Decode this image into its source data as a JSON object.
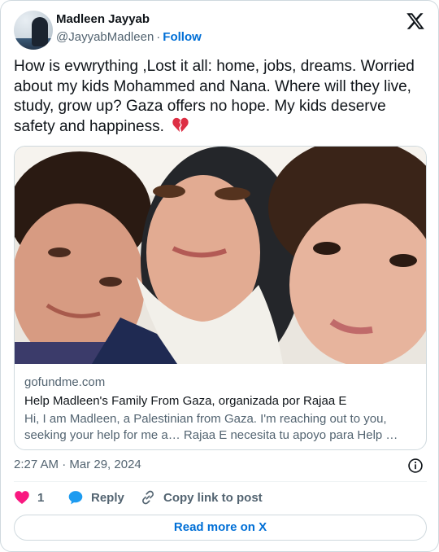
{
  "author": {
    "display_name": "Madleen Jayyab",
    "handle": "@JayyabMadleen",
    "separator": "·",
    "follow_label": "Follow"
  },
  "tweet": {
    "text": "How is evwrything ,Lost it all: home, jobs, dreams. Worried about my kids Mohammed and Nana. Where will they live, study, grow up? Gaza offers no hope. My kids deserve safety and happiness.",
    "emoji": "broken-heart-icon"
  },
  "link_card": {
    "domain": "gofundme.com",
    "title": "Help Madleen's Family From Gaza, organizada por Rajaa E",
    "description": "Hi, I am Madleen, a Palestinian from Gaza. I'm reaching out to you, seeking your help for me a… Rajaa E necesita tu apoyo para Help …"
  },
  "timestamp": "2:27 AM · Mar 29, 2024",
  "actions": {
    "like_count": "1",
    "reply_label": "Reply",
    "copy_label": "Copy link to post"
  },
  "read_more_label": "Read more on X",
  "colors": {
    "accent": "#006fd6",
    "like": "#f91880",
    "reply": "#1d9bf0",
    "secondary_text": "#536471"
  },
  "icons": [
    "x-logo-icon",
    "broken-heart-icon",
    "info-icon",
    "heart-icon",
    "reply-bubble-icon",
    "link-icon"
  ]
}
